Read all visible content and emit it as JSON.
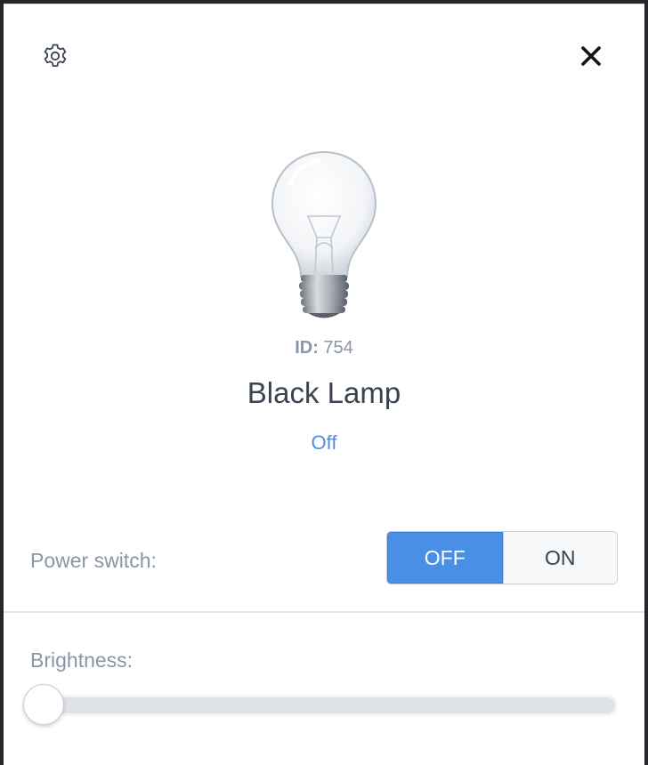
{
  "header": {
    "settings_icon": "gear-icon",
    "close_icon": "close-icon"
  },
  "device": {
    "image_icon": "light-bulb-icon",
    "id_label": "ID:",
    "id_value": "754",
    "name": "Black Lamp",
    "status": "Off"
  },
  "power": {
    "label": "Power switch:",
    "off_label": "OFF",
    "on_label": "ON",
    "selected": "OFF"
  },
  "brightness": {
    "label": "Brightness:",
    "value_fraction": 0
  },
  "colors": {
    "accent": "#4a8fe6",
    "muted_text": "#8a95a5",
    "primary_text": "#3a4350",
    "track": "#dfe3e8"
  }
}
